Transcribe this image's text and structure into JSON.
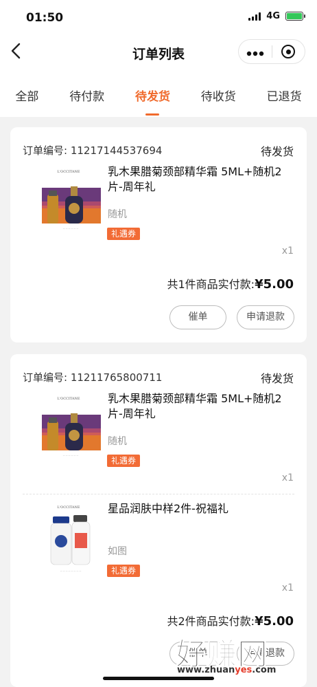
{
  "status_bar": {
    "time": "01:50",
    "network": "4G"
  },
  "nav": {
    "title": "订单列表",
    "back_icon": "chevron-left-icon",
    "more_icon": "more-dots-icon",
    "target_icon": "target-icon"
  },
  "tabs": [
    {
      "label": "全部",
      "active": false
    },
    {
      "label": "待付款",
      "active": false
    },
    {
      "label": "待发货",
      "active": true
    },
    {
      "label": "待收货",
      "active": false
    },
    {
      "label": "已退货",
      "active": false
    }
  ],
  "orders": [
    {
      "order_label": "订单编号: 11217144537694",
      "status": "待发货",
      "items": [
        {
          "name": "乳木果腊菊颈部精华霜 5ML+随机2片-周年礼",
          "spec": "随机",
          "tag": "礼遇券",
          "qty": "x1"
        }
      ],
      "total_prefix": "共1件商品实付款:",
      "total_amount": "¥5.00",
      "buttons": {
        "urge": "催单",
        "refund": "申请退款"
      }
    },
    {
      "order_label": "订单编号: 11211765800711",
      "status": "待发货",
      "items": [
        {
          "name": "乳木果腊菊颈部精华霜 5ML+随机2片-周年礼",
          "spec": "随机",
          "tag": "礼遇券",
          "qty": "x1"
        },
        {
          "name": "星品润肤中样2件-祝福礼",
          "spec": "如图",
          "tag": "礼遇券",
          "qty": "x1"
        }
      ],
      "total_prefix": "共2件商品实付款:",
      "total_amount": "¥5.00",
      "buttons": {
        "urge": "催单",
        "refund": "申请退款"
      }
    }
  ],
  "watermark": {
    "text": "好赚网",
    "url_prefix": "www.zhuan",
    "url_accent": "yes",
    "url_suffix": ".com"
  },
  "colors": {
    "accent": "#f06a2c",
    "tag_bg": "#f26b35",
    "page_bg": "#f2f2f2"
  }
}
